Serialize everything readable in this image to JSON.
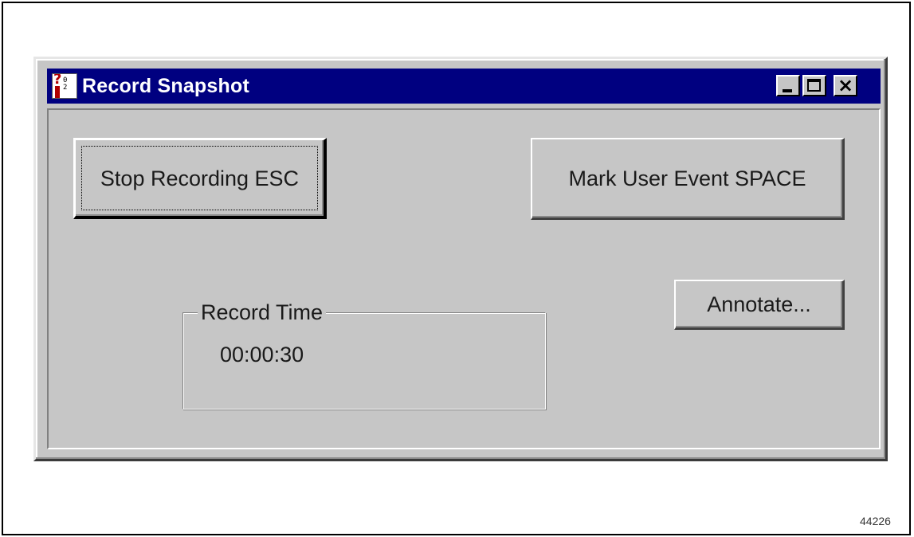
{
  "window": {
    "title": "Record Snapshot",
    "icon": "record-snapshot-app-icon",
    "icon_digits": "0\n2",
    "controls": {
      "minimize_icon": "minimize-icon",
      "maximize_icon": "maximize-icon",
      "close_icon": "close-icon",
      "close_glyph": "×"
    }
  },
  "buttons": {
    "stop_recording": "Stop Recording ESC",
    "mark_user_event": "Mark User Event SPACE",
    "annotate": "Annotate..."
  },
  "record_time": {
    "label": "Record Time",
    "value": "00:00:30"
  },
  "figure_id": "44226",
  "colors": {
    "titlebar": "#000080",
    "title_text": "#ffffff",
    "face": "#c6c6c6",
    "page_background": "#ffffff"
  }
}
